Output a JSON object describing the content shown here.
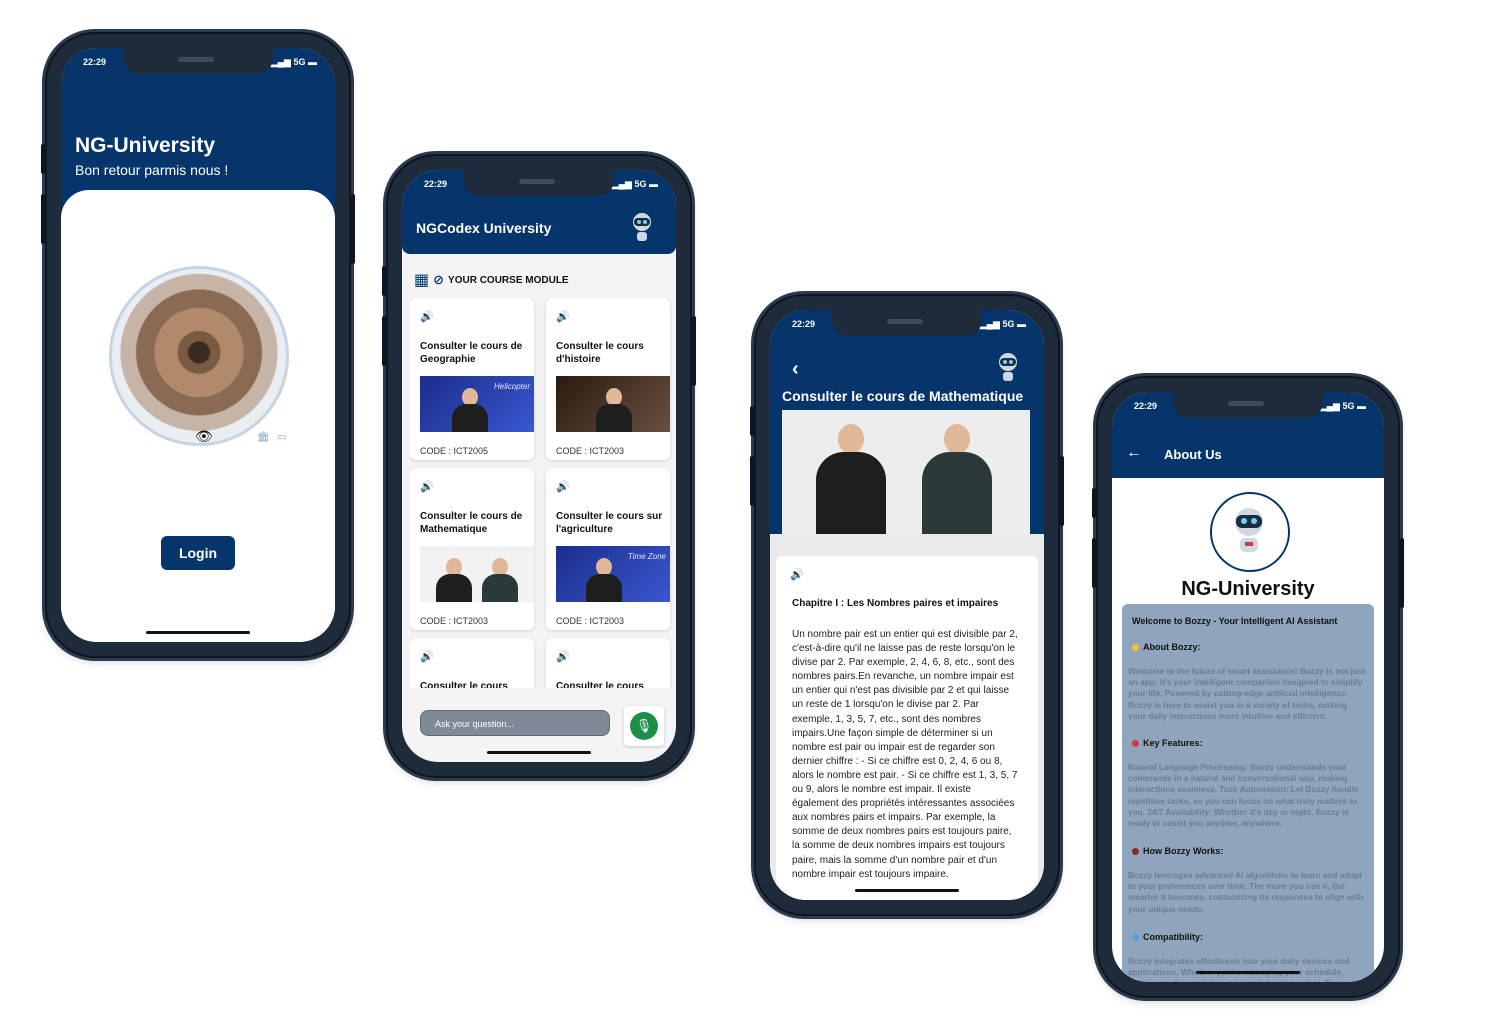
{
  "phone1": {
    "status_time": "22:29",
    "status_net": "5G",
    "title": "NG-University",
    "subtitle": "Bon retour parmis nous !",
    "login_label": "Login"
  },
  "phone2": {
    "status_time": "22:29",
    "status_net": "5G",
    "app_title": "NGCodex University",
    "module_label": "YOUR COURSE MODULE",
    "courses": [
      {
        "title": "Consulter le cours de Geographie",
        "code": "CODE : ICT2005",
        "thumb_caption": "Helicopter"
      },
      {
        "title": "Consulter le cours d'histoire",
        "code": "CODE : ICT2003",
        "thumb_caption": ""
      },
      {
        "title": "Consulter le cours de Mathematique",
        "code": "CODE : ICT2003",
        "thumb_caption": ""
      },
      {
        "title": "Consulter le cours sur l'agriculture",
        "code": "CODE : ICT2003",
        "thumb_caption": "Time Zone"
      },
      {
        "title": "Consulter le cours",
        "code": "",
        "thumb_caption": ""
      },
      {
        "title": "Consulter le cours",
        "code": "",
        "thumb_caption": ""
      }
    ],
    "ask_placeholder": "Ask your question..."
  },
  "phone3": {
    "status_time": "22:29",
    "status_net": "5G",
    "title": "Consulter le cours de Mathematique",
    "chapter": "Chapitre I : Les Nombres paires et impaires",
    "body": " Un nombre pair est un entier qui est divisible par 2, c'est-à-dire qu'il ne laisse pas de reste lorsqu'on le divise par 2. Par exemple, 2, 4, 6, 8, etc., sont des nombres pairs.En revanche, un nombre impair est un entier qui n'est pas divisible par 2 et qui laisse un reste de 1 lorsqu'on le divise par 2. Par exemple, 1, 3, 5, 7, etc., sont des nombres impairs.Une façon simple de déterminer si un nombre est pair ou impair est de regarder son dernier chiffre : - Si ce chiffre est 0, 2, 4, 6 ou 8, alors le nombre est pair. - Si ce chiffre est 1, 3, 5, 7 ou 9, alors le nombre est impair. Il existe également des propriétés intéressantes associées aux nombres pairs et impairs. Par exemple, la somme de deux nombres pairs est toujours paire, la somme de deux nombres impairs est toujours paire, mais la somme d'un nombre pair et d'un nombre impair est toujours impaire."
  },
  "phone4": {
    "status_time": "22:29",
    "status_net": "5G",
    "header_title": "About Us",
    "name": "NG-University",
    "welcome": "Welcome to Bozzy - Your Intelligent AI Assistant",
    "sections": [
      {
        "heading": "About Bozzy:",
        "dot_color": "#f2c12e",
        "text": "Welcome to the future of smart assistance! Bozzy is not just an app; it's your intelligent companion designed to simplify your life. Powered by cutting-edge artificial intelligence, Bozzy is here to assist you in a variety of tasks, making your daily interactions more intuitive and efficient."
      },
      {
        "heading": "Key Features:",
        "dot_color": "#d8334a",
        "text": "Natural Language Processing: Bozzy understands your commands in a natural and conversational way, making interactions seamless. Task Automation: Let Bozzy handle repetitive tasks, so you can focus on what truly matters to you. 24/7 Availability: Whether it's day or night, Bozzy is ready to assist you anytime, anywhere."
      },
      {
        "heading": "How Bozzy Works:",
        "dot_color": "#8a2a2a",
        "text": "Bozzy leverages advanced AI algorithms to learn and adapt to your preferences over time. The more you use it, the smarter it becomes, customizing its responses to align with your unique needs."
      },
      {
        "heading": "Compatibility:",
        "dot_color": "#5aa0e0",
        "text": "Bozzy integrates effortlessly into your daily devices and applications. Whether you're managing your schedule, getting weather updates, or simply having a chat, Bozzy is your go-to AI assistant."
      }
    ]
  }
}
